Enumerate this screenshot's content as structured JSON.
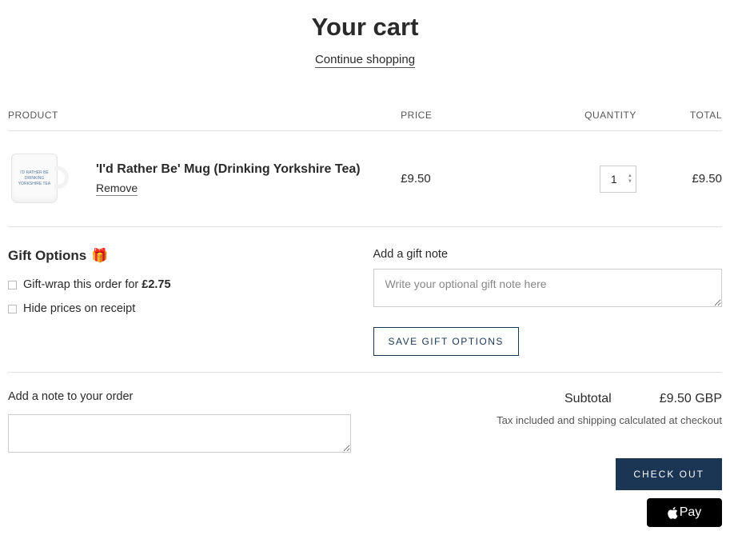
{
  "header": {
    "title": "Your cart",
    "continue_link": "Continue shopping"
  },
  "table": {
    "headers": {
      "product": "PRODUCT",
      "price": "PRICE",
      "quantity": "QUANTITY",
      "total": "TOTAL"
    },
    "item": {
      "name": "'I'd Rather Be' Mug (Drinking Yorkshire Tea)",
      "remove": "Remove",
      "price": "£9.50",
      "quantity": "1",
      "total": "£9.50",
      "imprint_l1": "I'D RATHER BE",
      "imprint_l2": "DRINKING",
      "imprint_l3": "YORKSHIRE TEA"
    }
  },
  "gift": {
    "heading": "Gift Options",
    "emoji": "🎁",
    "wrap_prefix": "Gift-wrap this order for ",
    "wrap_price": "£2.75",
    "hide_prices": "Hide prices on receipt",
    "note_label": "Add a gift note",
    "note_placeholder": "Write your optional gift note here",
    "save_button": "SAVE GIFT OPTIONS"
  },
  "order_note": {
    "label": "Add a note to your order"
  },
  "totals": {
    "subtotal_label": "Subtotal",
    "subtotal_value": "£9.50 GBP",
    "tax_note": "Tax included and shipping calculated at checkout",
    "checkout": "CHECK OUT",
    "apple_pay": "Pay"
  }
}
